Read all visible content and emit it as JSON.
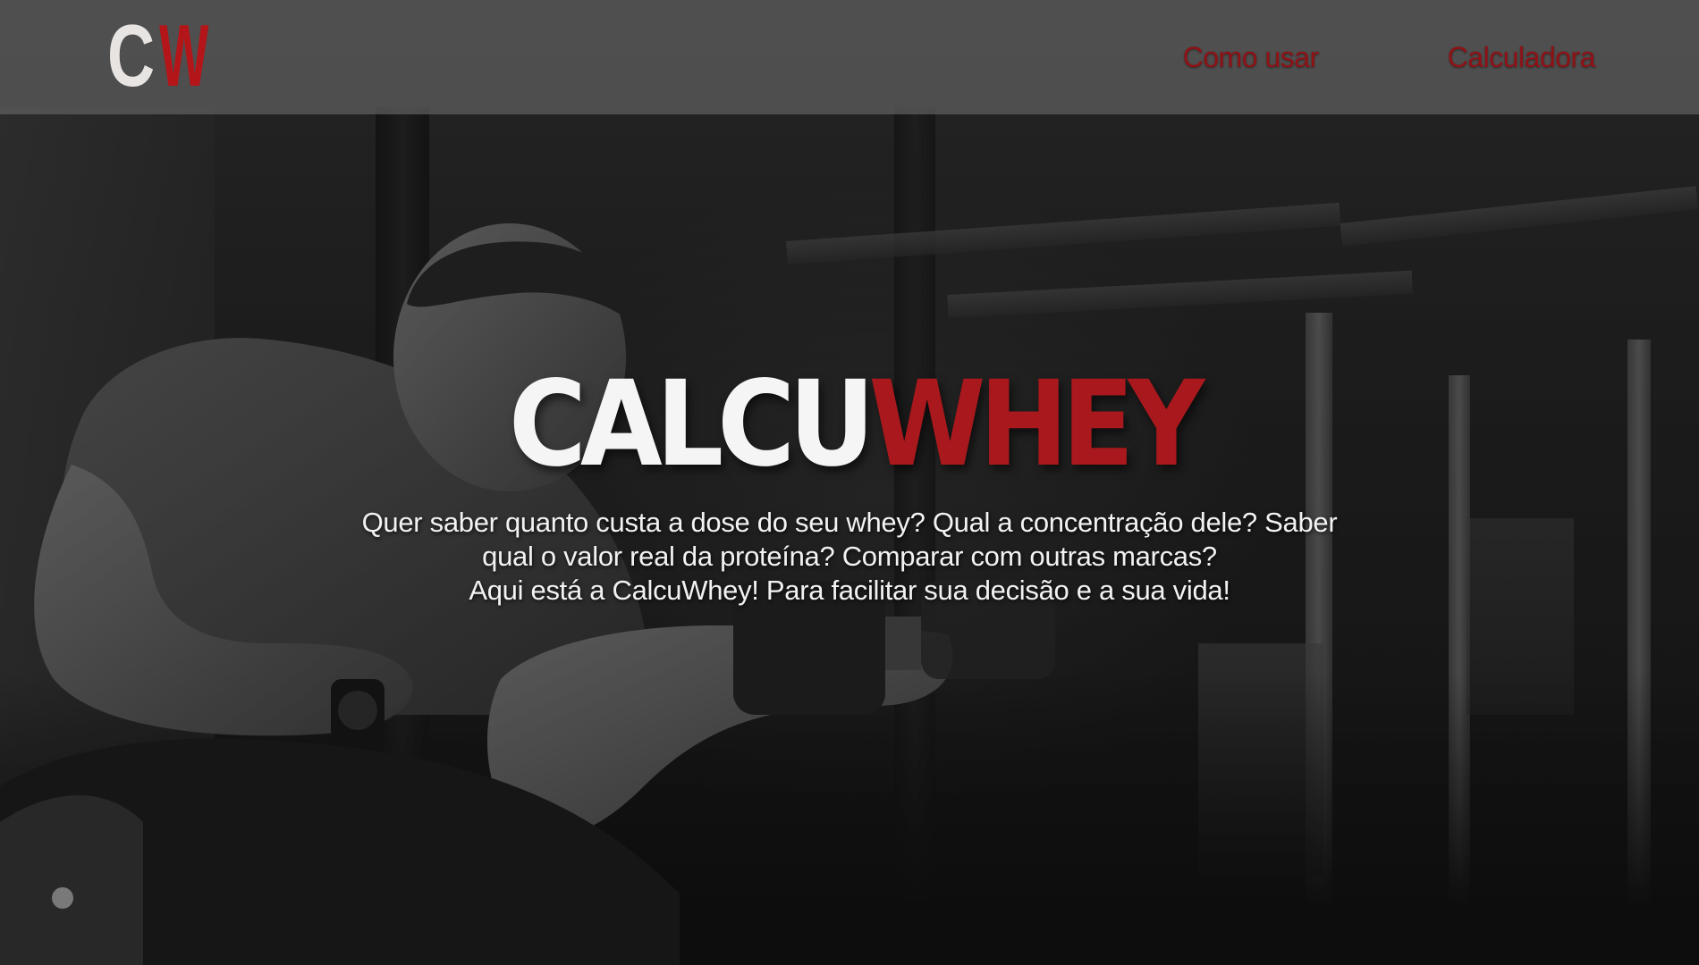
{
  "brand": {
    "logo_left": "C",
    "logo_right": "W",
    "logo_left_color": "#e8e4e2",
    "logo_right_color": "#b31519"
  },
  "nav": {
    "items": [
      {
        "label": "Como usar"
      },
      {
        "label": "Calculadora"
      }
    ],
    "link_color": "#8e1216"
  },
  "hero": {
    "title_part_a": "CALCU",
    "title_part_b": "WHEY",
    "title_part_a_color": "#f5f5f5",
    "title_part_b_color": "#a8181c",
    "lines": [
      "Quer saber quanto custa a dose do seu whey? Qual a concentração dele? Saber qual o valor real da proteína? Comparar com outras marcas?",
      "Aqui está a CalcuWhey! Para facilitar sua decisão e a sua vida!"
    ]
  },
  "background": {
    "description_icon": "gym-athlete-photo"
  }
}
